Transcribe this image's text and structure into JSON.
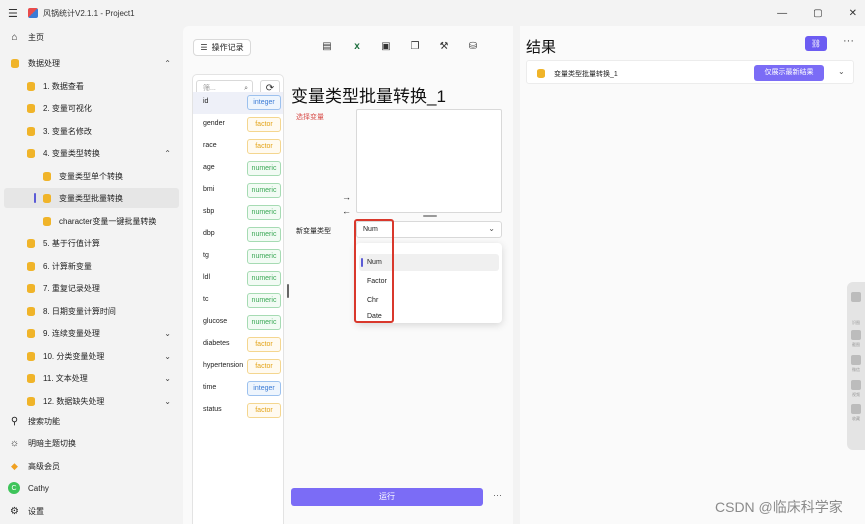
{
  "window": {
    "title": "风锅统计V2.1.1 - Project1",
    "controls": [
      "—",
      "▢",
      "✕"
    ]
  },
  "sidebar": {
    "home": "主页",
    "data_processing": "数据处理",
    "items": [
      {
        "label": "1. 数据查看"
      },
      {
        "label": "2. 变量可视化"
      },
      {
        "label": "3. 变量名修改"
      },
      {
        "label": "4. 变量类型转换"
      },
      {
        "label": "变量类型单个转换"
      },
      {
        "label": "变量类型批量转换"
      },
      {
        "label": "character变量一键批量转换"
      },
      {
        "label": "5. 基于行值计算"
      },
      {
        "label": "6. 计算新变量"
      },
      {
        "label": "7. 重复记录处理"
      },
      {
        "label": "8. 日期变量计算时间"
      },
      {
        "label": "9. 连续变量处理"
      },
      {
        "label": "10. 分类变量处理"
      },
      {
        "label": "11. 文本处理"
      },
      {
        "label": "12. 数据缺失处理"
      }
    ],
    "search": "搜索功能",
    "theme": "明暗主题切换",
    "vip": "高级会员",
    "user": "Cathy",
    "user_initial": "C",
    "settings": "设置"
  },
  "center": {
    "operation_record": "操作记录",
    "search_placeholder": "筛...",
    "title": "变量类型批量转换_1",
    "select_var_label": "选择变量",
    "new_type_label": "新变量类型",
    "selected_type": "Num",
    "options": [
      "Num",
      "Factor",
      "Chr",
      "Date"
    ],
    "run": "运行",
    "more": "···"
  },
  "variables": [
    {
      "name": "id",
      "type": "integer"
    },
    {
      "name": "gender",
      "type": "factor"
    },
    {
      "name": "race",
      "type": "factor"
    },
    {
      "name": "age",
      "type": "numeric"
    },
    {
      "name": "bmi",
      "type": "numeric"
    },
    {
      "name": "sbp",
      "type": "numeric"
    },
    {
      "name": "dbp",
      "type": "numeric"
    },
    {
      "name": "tg",
      "type": "numeric"
    },
    {
      "name": "ldl",
      "type": "numeric"
    },
    {
      "name": "tc",
      "type": "numeric"
    },
    {
      "name": "glucose",
      "type": "numeric"
    },
    {
      "name": "diabetes",
      "type": "factor"
    },
    {
      "name": "hypertension",
      "type": "factor"
    },
    {
      "name": "time",
      "type": "integer"
    },
    {
      "name": "status",
      "type": "factor"
    }
  ],
  "results": {
    "title": "结果",
    "more": "···",
    "row_name": "变量类型批量转换_1",
    "latest_button": "仅展示最新结果"
  },
  "side_widget": [
    "识图",
    "截图",
    "微信",
    "视频",
    "收藏"
  ],
  "watermark": "CSDN @临床科学家",
  "colors": {
    "accent": "#7b6cf6",
    "highlight": "#d9382c",
    "folder": "#f0b429"
  }
}
